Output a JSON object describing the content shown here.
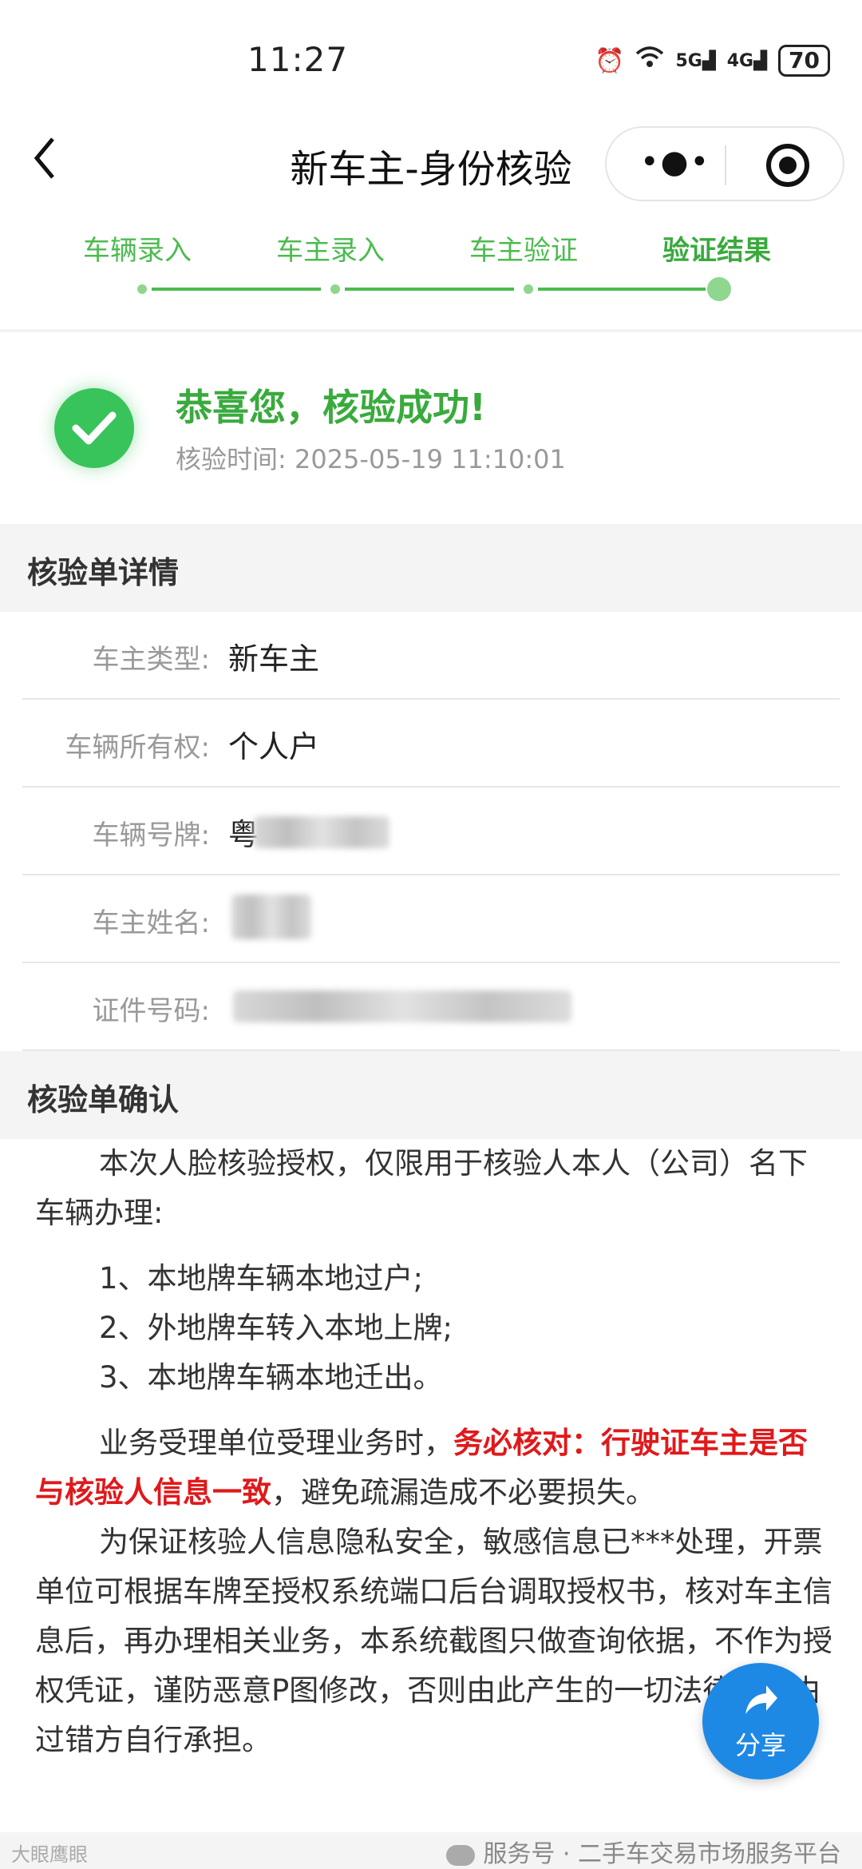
{
  "status_bar": {
    "time": "11:27",
    "signal1": "5G",
    "signal2": "4G",
    "battery": "70"
  },
  "header": {
    "title": "新车主-身份核验",
    "back_icon": "back-chevron-icon",
    "more_icon": "more-dots-icon",
    "close_icon": "mini-program-close-icon"
  },
  "steps": [
    {
      "label": "车辆录入",
      "active": false
    },
    {
      "label": "车主录入",
      "active": false
    },
    {
      "label": "车主验证",
      "active": false
    },
    {
      "label": "验证结果",
      "active": true
    }
  ],
  "success": {
    "title": "恭喜您，核验成功!",
    "time_label": "核验时间:",
    "time_value": "2025-05-19 11:10:01"
  },
  "details": {
    "section_title": "核验单详情",
    "rows": [
      {
        "label": "车主类型:",
        "value": "新车主"
      },
      {
        "label": "车辆所有权:",
        "value": "个人户"
      },
      {
        "label": "车辆号牌:",
        "value": "粤"
      },
      {
        "label": "车主姓名:",
        "value": ""
      },
      {
        "label": "证件号码:",
        "value": ""
      }
    ]
  },
  "confirm": {
    "section_title": "核验单确认",
    "intro": "本次人脸核验授权，仅限用于核验人本人（公司）名下车辆办理:",
    "items": [
      "1、本地牌车辆本地过户;",
      "2、外地牌车转入本地上牌;",
      "3、本地牌车辆本地迁出。"
    ],
    "p2_prefix": "业务受理单位受理业务时，",
    "p2_red": "务必核对：行驶证车主是否与核验人信息一致",
    "p2_suffix": "，避免疏漏造成不必要损失。",
    "p3": "为保证核验人信息隐私安全，敏感信息已***处理，开票单位可根据车牌至授权系统端口后台调取授权书，核对车主信息后，再办理相关业务，本系统截图只做查询依据，不作为授权凭证，谨防恶意P图修改，否则由此产生的一切法律责任由过错方自行承担。"
  },
  "share": {
    "label": "分享",
    "icon": "share-arrow-icon"
  },
  "watermark": {
    "left": "大眼鹰眼",
    "right": "服务号 · 二手车交易市场服务平台"
  },
  "colors": {
    "green": "#4cbb4f",
    "success_green": "#39c35b",
    "red": "#e0191b",
    "share_blue": "#1e88e5"
  }
}
